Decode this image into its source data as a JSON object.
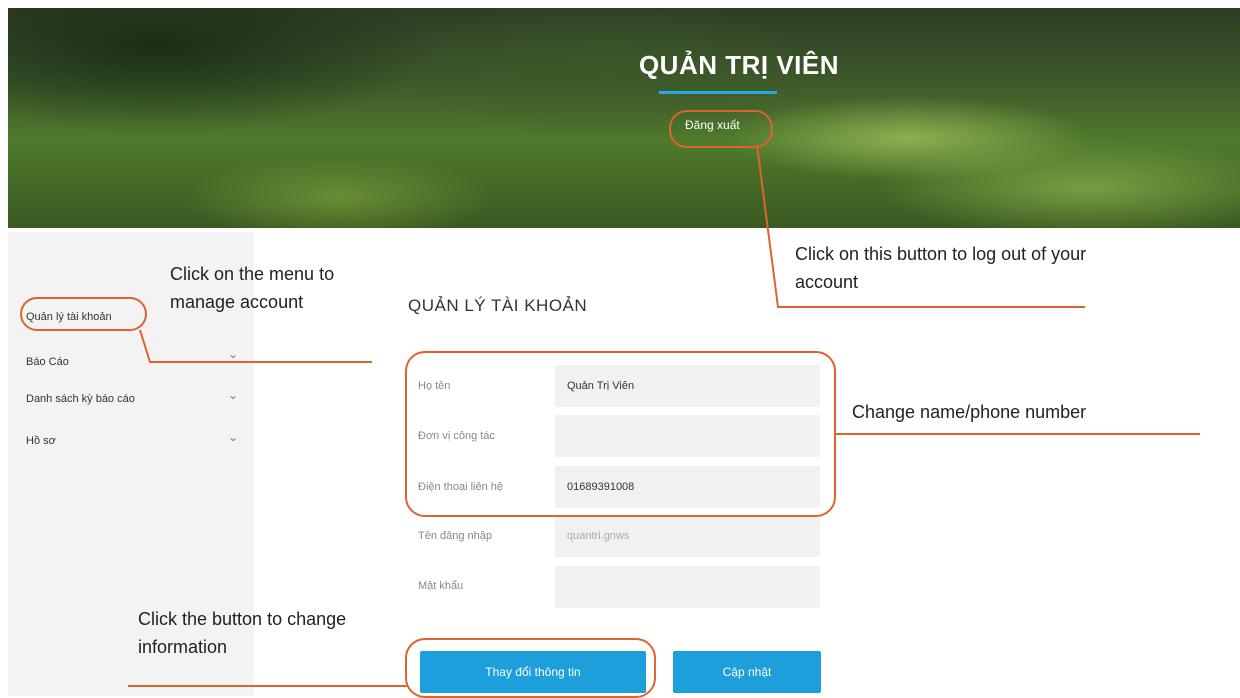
{
  "banner": {
    "title": "QUẢN TRỊ VIÊN",
    "logout_label": "Đăng xuất"
  },
  "sidebar": {
    "items": [
      {
        "label": "Quản lý tài khoản",
        "has_chevron": false
      },
      {
        "label": "Báo Cáo",
        "has_chevron": true
      },
      {
        "label": "Danh sách kỳ báo cáo",
        "has_chevron": true
      },
      {
        "label": "Hồ sơ",
        "has_chevron": true
      }
    ]
  },
  "main": {
    "title": "QUẢN LÝ TÀI KHOẢN",
    "fields": [
      {
        "label": "Họ tên",
        "value": "Quản Trị Viên"
      },
      {
        "label": "Đơn vị công tác",
        "value": ""
      },
      {
        "label": "Điện thoại liên hệ",
        "value": "01689391008"
      },
      {
        "label": "Tên đăng nhập",
        "value": "quantri.gnws"
      },
      {
        "label": "Mật khẩu",
        "value": ""
      }
    ],
    "buttons": {
      "change_info": "Thay đổi thông tin",
      "update": "Cập nhật"
    }
  },
  "annotations": {
    "logout_note": "Click on this button to log out of your account",
    "menu_note": "Click on the menu to manage account",
    "name_phone_note": "Change name/phone number",
    "change_button_note": "Click the button to change information"
  },
  "colors": {
    "accent": "#1d9fdc",
    "callout": "#e0622e",
    "sidebar_bg": "#f3f3f3",
    "field_bg": "#f1f1f1"
  }
}
